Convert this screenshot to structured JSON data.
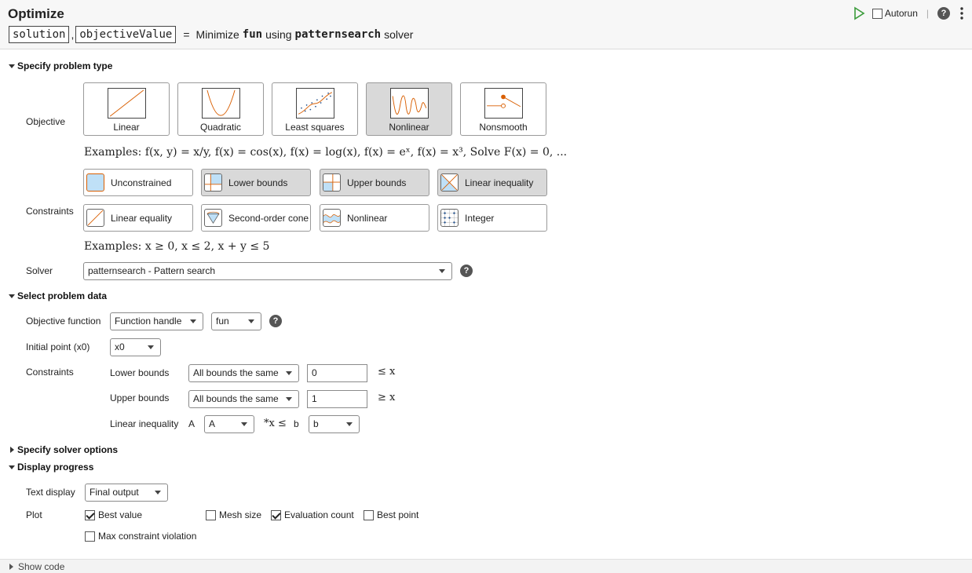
{
  "header": {
    "title": "Optimize",
    "outputs": [
      "solution",
      "objectiveValue"
    ],
    "comma": ",",
    "equals": "=",
    "minimize": "Minimize",
    "fun": "fun",
    "using": "using",
    "solver": "patternsearch",
    "solver_suffix": "solver",
    "autorun_label": "Autorun",
    "autorun_checked": false,
    "divider": "|",
    "help_glyph": "?"
  },
  "problem_type": {
    "heading": "Specify problem type",
    "objective_label": "Objective",
    "objectives": [
      "Linear",
      "Quadratic",
      "Least squares",
      "Nonlinear",
      "Nonsmooth"
    ],
    "selected_objective": "Nonlinear",
    "objective_examples": "Examples: f(x, y) = x/y, f(x) = cos(x), f(x) = log(x), f(x) = eˣ, f(x) = x³, Solve F(x) = 0, ...",
    "constraints_label": "Constraints",
    "constraints": [
      "Unconstrained",
      "Lower bounds",
      "Upper bounds",
      "Linear inequality",
      "Linear equality",
      "Second-order cone",
      "Nonlinear",
      "Integer"
    ],
    "selected_constraints": [
      "Lower bounds",
      "Upper bounds",
      "Linear inequality"
    ],
    "constraint_examples": "Examples: x ≥ 0, x ≤ 2, x + y ≤ 5",
    "solver_label": "Solver",
    "solver_value": "patternsearch - Pattern search"
  },
  "problem_data": {
    "heading": "Select problem data",
    "objective_function_label": "Objective function",
    "objective_function_type": "Function handle",
    "objective_function_value": "fun",
    "initial_point_label": "Initial point (x0)",
    "initial_point_value": "x0",
    "constraints_label": "Constraints",
    "lower_bounds_label": "Lower bounds",
    "lower_bounds_mode": "All bounds the same",
    "lower_bounds_value": "0",
    "lower_bounds_suffix": "≤ x",
    "upper_bounds_label": "Upper bounds",
    "upper_bounds_mode": "All bounds the same",
    "upper_bounds_value": "1",
    "upper_bounds_suffix": "≥ x",
    "linear_inequality_label": "Linear inequality",
    "A_label": "A",
    "A_value": "A",
    "A_relation": "*x ≤",
    "b_label": "b",
    "b_value": "b"
  },
  "solver_options": {
    "heading": "Specify solver options"
  },
  "display_progress": {
    "heading": "Display progress",
    "text_display_label": "Text display",
    "text_display_value": "Final output",
    "plot_label": "Plot",
    "plots": [
      {
        "label": "Best value",
        "checked": true
      },
      {
        "label": "Mesh size",
        "checked": false
      },
      {
        "label": "Evaluation count",
        "checked": true
      },
      {
        "label": "Best point",
        "checked": false
      },
      {
        "label": "Max constraint violation",
        "checked": false
      }
    ]
  },
  "footer": {
    "show_code": "Show code"
  },
  "colors": {
    "accent_orange": "#d95f02",
    "run_green": "#3a9b3a",
    "selected_bg": "#d9d9d9",
    "bound_fill": "#bfe0f7"
  }
}
